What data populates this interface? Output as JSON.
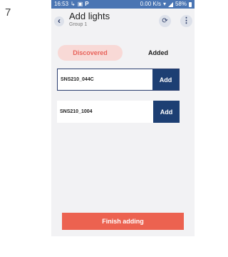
{
  "step_number": "7",
  "status_bar": {
    "time": "16:53",
    "left_icons": [
      "↳",
      "▣",
      "P"
    ],
    "network_speed": "0.00 K/s",
    "battery": "58%"
  },
  "header": {
    "title": "Add lights",
    "subtitle": "Group 1",
    "back_icon": "chevron-left",
    "refresh_icon": "refresh",
    "more_icon": "more-vertical"
  },
  "tabs": [
    {
      "label": "Discovered",
      "active": true
    },
    {
      "label": "Added",
      "active": false
    }
  ],
  "lights": [
    {
      "name": "SNS210_044C",
      "action": "Add"
    },
    {
      "name": "SNS210_1004",
      "action": "Add"
    }
  ],
  "footer": {
    "finish_label": "Finish adding"
  },
  "colors": {
    "status_bar": "#4a75b3",
    "accent": "#ec6250",
    "active_tab_bg": "#f8d9d6",
    "add_button": "#1d3f73",
    "background": "#f2f2f4"
  }
}
